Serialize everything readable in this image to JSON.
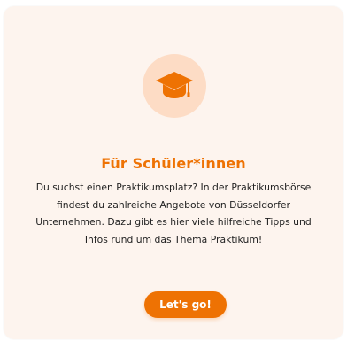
{
  "card": {
    "icon": "graduation-cap-icon",
    "title": "Für Schüler*innen",
    "description": "Du suchst einen Praktikumsplatz? In der Praktikumsbörse findest du zahlreiche Angebote von Düsseldorfer Unternehmen. Dazu gibt es hier viele hilfreiche Tipps und Infos rund um das Thema Praktikum!",
    "cta_label": "Let's go!"
  },
  "colors": {
    "accent": "#ee7203",
    "card_background": "#fdf4ee",
    "icon_circle": "#fddcc5",
    "text": "#222222"
  }
}
